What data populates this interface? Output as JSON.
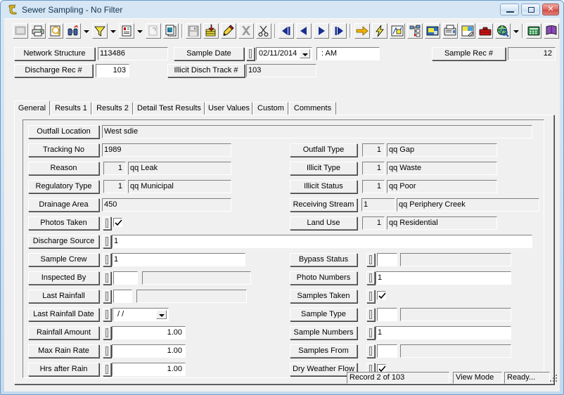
{
  "window": {
    "title": "Sewer Sampling - No Filter",
    "app_icon": "sewer-hook-icon",
    "caption_buttons": {
      "minimize": "minimize-button",
      "maximize": "maximize-button",
      "close": "✕"
    }
  },
  "toolbar": {
    "items": [
      {
        "name": "print-preview-grid-icon",
        "enabled": false
      },
      {
        "name": "print-icon",
        "enabled": true
      },
      {
        "name": "find-magnifier-icon",
        "enabled": true
      },
      {
        "name": "sort-binoculars-icon",
        "enabled": true
      },
      {
        "name": "sort-dropdown-arrow",
        "enabled": true,
        "kind": "arrow"
      },
      {
        "name": "filter-funnel-icon",
        "enabled": true
      },
      {
        "name": "filter-dropdown-arrow",
        "enabled": true,
        "kind": "arrow"
      },
      {
        "name": "report-page-icon",
        "enabled": true
      },
      {
        "name": "report-dropdown-arrow",
        "enabled": true,
        "kind": "arrow"
      },
      {
        "name": "export-page-icon",
        "enabled": false
      },
      {
        "name": "copy-records-icon",
        "enabled": true
      },
      {
        "name": "separator-1",
        "kind": "sep"
      },
      {
        "name": "save-disk-icon",
        "enabled": false
      },
      {
        "name": "add-record-icon",
        "enabled": true
      },
      {
        "name": "edit-pencil-icon",
        "enabled": true
      },
      {
        "name": "delete-x-icon",
        "enabled": false
      },
      {
        "name": "cut-scissors-icon",
        "enabled": true
      },
      {
        "name": "separator-2",
        "kind": "sep"
      },
      {
        "name": "first-record-icon",
        "enabled": true
      },
      {
        "name": "previous-record-icon",
        "enabled": true
      },
      {
        "name": "next-record-icon",
        "enabled": true
      },
      {
        "name": "last-record-icon",
        "enabled": true
      },
      {
        "name": "separator-3",
        "kind": "sep"
      },
      {
        "name": "goto-arrow-icon",
        "enabled": true
      },
      {
        "name": "lightning-action-icon",
        "enabled": true
      },
      {
        "name": "map-view-icon",
        "enabled": true
      },
      {
        "name": "tree-hierarchy-icon",
        "enabled": true
      },
      {
        "name": "image-viewer-icon",
        "enabled": true
      },
      {
        "name": "fax-icon",
        "enabled": true
      },
      {
        "name": "picture-edit-icon",
        "enabled": true
      },
      {
        "name": "toolbox-icon",
        "enabled": true
      },
      {
        "name": "globe-search-icon",
        "enabled": true
      },
      {
        "name": "globe-dropdown-arrow",
        "enabled": true,
        "kind": "arrow"
      },
      {
        "name": "separator-4",
        "kind": "sep"
      },
      {
        "name": "calculator-icon",
        "enabled": true
      },
      {
        "name": "help-book-icon",
        "enabled": true
      },
      {
        "name": "help-dropdown-arrow",
        "enabled": true,
        "kind": "arrow"
      },
      {
        "name": "separator-5",
        "kind": "sep"
      },
      {
        "name": "exit-door-icon",
        "enabled": true
      }
    ]
  },
  "header": {
    "network_structure": {
      "label": "Network Structure",
      "value": "113486"
    },
    "sample_date": {
      "label": "Sample Date",
      "value": "02/11/2014"
    },
    "sample_time": {
      "value": ":    AM"
    },
    "sample_rec": {
      "label": "Sample Rec #",
      "value": "12"
    },
    "discharge_rec": {
      "label": "Discharge Rec #",
      "value": "103"
    },
    "illicit_disch_track": {
      "label": "Illicit Disch Track #",
      "value": "103"
    }
  },
  "tabs": {
    "items": [
      {
        "label": "General",
        "active": true
      },
      {
        "label": "Results 1",
        "active": false
      },
      {
        "label": "Results 2",
        "active": false
      },
      {
        "label": "Detail Test Results",
        "active": false
      },
      {
        "label": "User Values",
        "active": false
      },
      {
        "label": "Custom",
        "active": false
      },
      {
        "label": "Comments",
        "active": false
      }
    ]
  },
  "general": {
    "left_fields": [
      {
        "label": "Outfall Location",
        "code": "",
        "value": "West sdie",
        "type": "text-wide"
      },
      {
        "label": "Tracking No",
        "code": "",
        "value": "1989",
        "type": "text"
      },
      {
        "label": "Reason",
        "code": "1",
        "value": "qq Leak",
        "type": "code-text"
      },
      {
        "label": "Regulatory Type",
        "code": "1",
        "value": "qq Municipal",
        "type": "code-text"
      },
      {
        "label": "Drainage Area",
        "code": "",
        "value": "450",
        "type": "text"
      },
      {
        "label": "Photos Taken",
        "code": "",
        "value": "",
        "type": "elev-check",
        "checked": true
      },
      {
        "label": "Discharge Source",
        "code": "",
        "value": "1",
        "type": "elev-text-wide"
      },
      {
        "label": "Sample Crew",
        "code": "",
        "value": "1",
        "type": "elev-text"
      },
      {
        "label": "Inspected By",
        "code": "",
        "value": "",
        "type": "elev-code-text"
      },
      {
        "label": "Last Rainfall",
        "code": "",
        "value": "",
        "type": "elev-code-text-sm"
      },
      {
        "label": "Last Rainfall Date",
        "code": "",
        "value": "/  /",
        "type": "elev-date"
      },
      {
        "label": "Rainfall Amount",
        "code": "",
        "value": "1.00",
        "type": "elev-num"
      },
      {
        "label": "Max Rain Rate",
        "code": "",
        "value": "1.00",
        "type": "elev-num"
      },
      {
        "label": "Hrs after Rain",
        "code": "",
        "value": "1.00",
        "type": "elev-num"
      }
    ],
    "right_fields": [
      {
        "label": "Outfall Type",
        "code": "1",
        "value": "qq Gap",
        "type": "code-text"
      },
      {
        "label": "Illicit Type",
        "code": "1",
        "value": "qq Waste",
        "type": "code-text"
      },
      {
        "label": "Illicit Status",
        "code": "1",
        "value": "qq Poor",
        "type": "code-text"
      },
      {
        "label": "Receiving Stream",
        "code": "1",
        "value": "qq Periphery Creek",
        "type": "code-text-wide"
      },
      {
        "label": "Land Use",
        "code": "1",
        "value": "qq Residential",
        "type": "code-text"
      },
      {
        "label": "Bypass Status",
        "code": "",
        "value": "",
        "type": "elev-code-text"
      },
      {
        "label": "Photo Numbers",
        "code": "",
        "value": "1",
        "type": "elev-text"
      },
      {
        "label": "Samples Taken",
        "code": "",
        "value": "",
        "type": "elev-check",
        "checked": true
      },
      {
        "label": "Sample Type",
        "code": "",
        "value": "",
        "type": "elev-code-text"
      },
      {
        "label": "Sample Numbers",
        "code": "",
        "value": "1",
        "type": "elev-text"
      },
      {
        "label": "Samples From",
        "code": "",
        "value": "",
        "type": "elev-code-text"
      },
      {
        "label": "Dry Weather Flow",
        "code": "",
        "value": "",
        "type": "elev-check",
        "checked": true
      }
    ]
  },
  "statusbar": {
    "record": "Record 2 of 103",
    "mode": "View Mode",
    "state": "Ready..."
  },
  "colors": {
    "window_frame": "#6b9dc6",
    "titlebar": "#d6e6f5",
    "client": "#f0f0f0",
    "field_readonly": "#f0f0f0",
    "field_editable": "#ffffff",
    "close_button": "#cf4a42"
  }
}
